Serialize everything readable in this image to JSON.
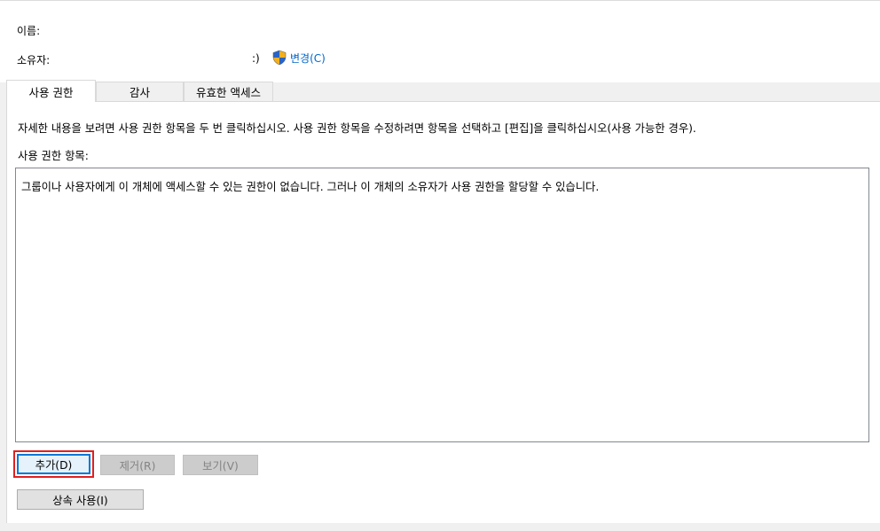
{
  "header": {
    "name_label": "이름:",
    "owner_label": "소유자:",
    "owner_value": ":)",
    "change_link": "변경(C)",
    "shield_icon": "uac-shield-icon"
  },
  "tabs": [
    {
      "label": "사용 권한",
      "active": true
    },
    {
      "label": "감사",
      "active": false
    },
    {
      "label": "유효한 액세스",
      "active": false
    }
  ],
  "panel": {
    "instructions": "자세한 내용을 보려면 사용 권한 항목을 두 번 클릭하십시오. 사용 권한 항목을 수정하려면 항목을 선택하고 [편집]을 클릭하십시오(사용 가능한 경우).",
    "entries_label": "사용 권한 항목:",
    "list_message": "그룹이나 사용자에게 이 개체에 액세스할 수 있는 권한이 없습니다. 그러나 이 개체의 소유자가 사용 권한을 할당할 수 있습니다."
  },
  "buttons": {
    "add": "추가(D)",
    "remove": "제거(R)",
    "view": "보기(V)",
    "inheritance": "상속 사용(I)"
  },
  "colors": {
    "link": "#0066cc",
    "highlight": "#e02020",
    "focus_border": "#0078d7"
  }
}
